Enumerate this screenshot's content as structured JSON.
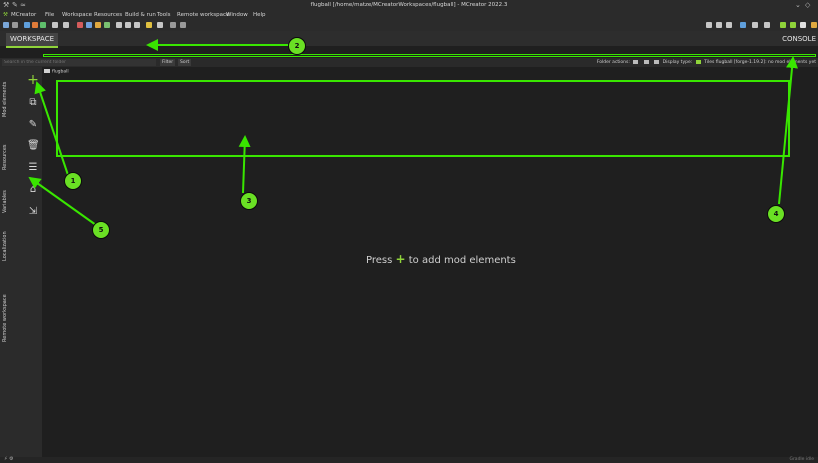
{
  "window": {
    "title": "flugball [/home/matze/MCreatorWorkspaces/flugball] - MCreator 2022.3"
  },
  "menubar": {
    "items": [
      "MCreator",
      "File",
      "Workspace",
      "Resources",
      "Build & run",
      "Tools",
      "Remote workspace",
      "Window",
      "Help"
    ]
  },
  "tabs": {
    "workspace": "WORKSPACE",
    "console": "CONSOLE"
  },
  "filter_row": {
    "search_placeholder": "Search in the current folder",
    "filter_label": "Filter",
    "sort_label": "Sort",
    "folder_actions_label": "Folder actions:",
    "display_type_label": "Display type:",
    "tiles_label": "Tiles",
    "status_text": "flugball [forge-1.19.2]: no mod elements yet"
  },
  "side_tabs": [
    "Mod elements",
    "Resources",
    "Variables",
    "Localization",
    "Remote workspace"
  ],
  "left_tools": [
    "add-element-icon",
    "duplicate-icon",
    "edit-icon",
    "delete-icon",
    "variables-icon",
    "locked-code-icon",
    "export-icon"
  ],
  "breadcrumb": {
    "folder": "flugball"
  },
  "main": {
    "hint_prefix": "Press",
    "hint_plus": "+",
    "hint_suffix": "to add mod elements"
  },
  "status_bar": {
    "left": "⚡ ⚙",
    "right": "Gradle idle"
  },
  "annotations": {
    "badges": [
      "1",
      "2",
      "3",
      "4",
      "5"
    ],
    "color": "#39e600"
  }
}
